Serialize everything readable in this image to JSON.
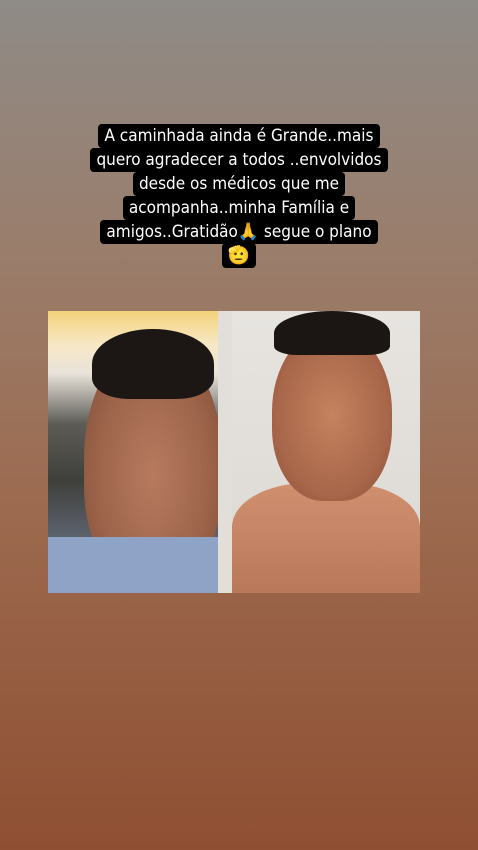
{
  "story": {
    "caption_lines": [
      "A caminhada ainda é Grande..mais",
      "quero agradecer a todos ..envolvidos",
      "desde os médicos que me",
      "acompanha..minha Família  e",
      "amigos..Gratidão🙏 segue o plano"
    ],
    "caption_emoji": "🫡"
  }
}
